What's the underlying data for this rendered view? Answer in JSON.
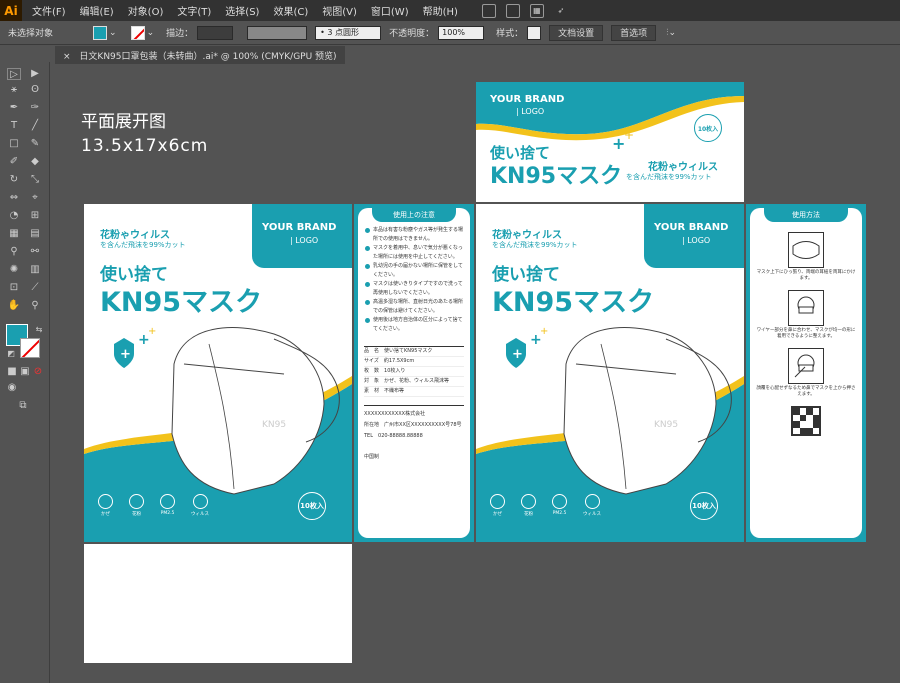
{
  "app": {
    "logo": "Ai"
  },
  "menu": [
    "文件(F)",
    "编辑(E)",
    "对象(O)",
    "文字(T)",
    "选择(S)",
    "效果(C)",
    "视图(V)",
    "窗口(W)",
    "帮助(H)"
  ],
  "control": {
    "selection": "未选择对象",
    "stroke_label": "描边：",
    "brush": "3 点圆形",
    "opacity_label": "不透明度：",
    "opacity_value": "100%",
    "style_label": "样式：",
    "doc_settings": "文档设置",
    "prefs": "首选项"
  },
  "tab": {
    "title": "日文KN95口罩包装（未转曲）.ai* @ 100% (CMYK/GPU 预览)"
  },
  "canvas": {
    "title_line1": "平面展开图",
    "title_line2": "13.5x17x6cm"
  },
  "brand": {
    "name": "YOUR BRAND",
    "logo": "| LOGO"
  },
  "product": {
    "pollen": "花粉ゃウィルス",
    "filter": "を含んだ飛沫を99%カット",
    "disposable": "使い捨て",
    "name": "KN95マスク",
    "count": "10枚入",
    "mask_mark": "KN95"
  },
  "icons": [
    {
      "label": "かぜ"
    },
    {
      "label": "花粉"
    },
    {
      "label": "PM2.5"
    },
    {
      "label": "ウィルス"
    }
  ],
  "notes_panel": {
    "title": "使用上の注意",
    "notes": [
      "本品は有害な粉塵やガス等が発生する場所での使用はできません。",
      "マスクを着用中、息いで気分が悪くなった場所には使用を中止してください。",
      "乳幼児の手の届かない場所に保管をしてください。",
      "マスクは使いきりタイプですので洗って再使用しないでください。",
      "高温多湿な場所、直射日光のあたる場所での保管は避けてください。",
      "使用後は地方自治体の区分によって捨ててください。"
    ],
    "specs": [
      {
        "k": "品　名",
        "v": "使い捨てKN95マスク"
      },
      {
        "k": "サイズ",
        "v": "約17.5X9cm"
      },
      {
        "k": "枚　数",
        "v": "10枚入り"
      },
      {
        "k": "対　象",
        "v": "かぜ、花粉、ウィルス飛沫等"
      },
      {
        "k": "素　材",
        "v": "不織布等"
      }
    ],
    "company": "XXXXXXXXXXXX株式会社",
    "address_label": "所在地",
    "address": "广州市XX区XXXXXXXXXX号78号",
    "tel_label": "TEL",
    "tel": "020-88888.88888",
    "origin": "中国制"
  },
  "usage_panel": {
    "title": "使用方法",
    "steps": [
      "マスク上下にひっ張り、両端の耳紐を両耳にかけます。",
      "ワイヤー部分を鼻に合わせ、マスクが均一の形に着用できるように整えます。",
      "顔覆を心配せずなるため鼻でマスクを上から押さえます。"
    ]
  }
}
